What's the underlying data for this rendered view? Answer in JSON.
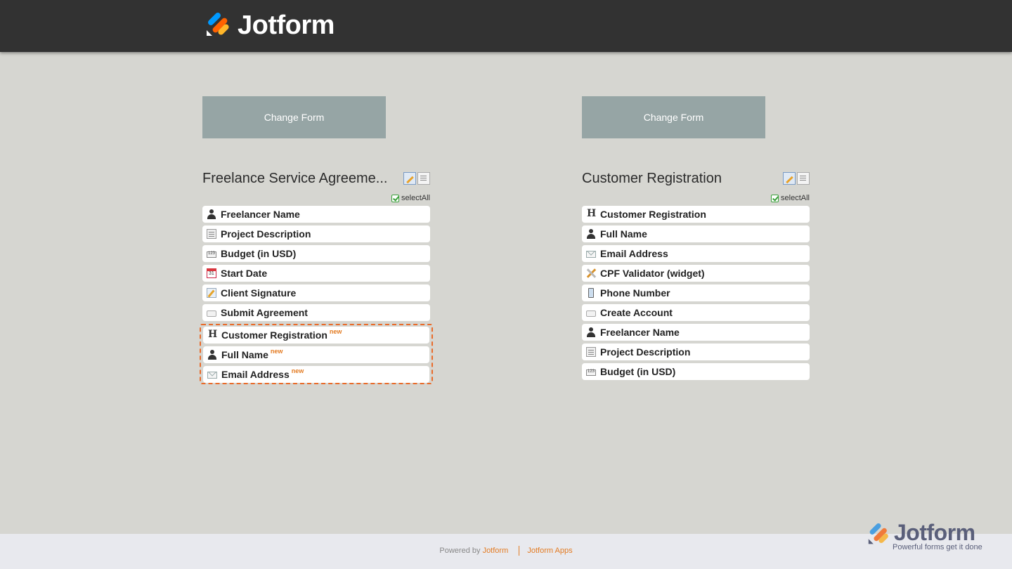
{
  "header": {
    "logo_text": "Jotform",
    "brand_colors": {
      "orange": "#ff6100",
      "yellow": "#ffb629",
      "blue": "#0099ff",
      "dark": "#323232"
    }
  },
  "left_form": {
    "change_label": "Change Form",
    "title": "Freelance Service Agreeme...",
    "select_all_label": "selectAll",
    "fields": [
      {
        "label": "Freelancer Name",
        "icon": "person-icon"
      },
      {
        "label": "Project Description",
        "icon": "textarea-icon"
      },
      {
        "label": "Budget (in USD)",
        "icon": "number-icon"
      },
      {
        "label": "Start Date",
        "icon": "calendar-icon"
      },
      {
        "label": "Client Signature",
        "icon": "signature-icon"
      },
      {
        "label": "Submit Agreement",
        "icon": "button-icon"
      }
    ],
    "new_fields": [
      {
        "label": "Customer Registration",
        "icon": "heading-icon",
        "tag": "new"
      },
      {
        "label": "Full Name",
        "icon": "person-icon",
        "tag": "new"
      },
      {
        "label": "Email Address",
        "icon": "email-icon",
        "tag": "new"
      }
    ]
  },
  "right_form": {
    "change_label": "Change Form",
    "title": "Customer Registration",
    "select_all_label": "selectAll",
    "fields": [
      {
        "label": "Customer Registration",
        "icon": "heading-icon"
      },
      {
        "label": "Full Name",
        "icon": "person-icon"
      },
      {
        "label": "Email Address",
        "icon": "email-icon"
      },
      {
        "label": "CPF Validator (widget)",
        "icon": "widget-icon"
      },
      {
        "label": "Phone Number",
        "icon": "phone-icon"
      },
      {
        "label": "Create Account",
        "icon": "button-icon"
      },
      {
        "label": "Freelancer Name",
        "icon": "person-icon"
      },
      {
        "label": "Project Description",
        "icon": "textarea-icon"
      },
      {
        "label": "Budget (in USD)",
        "icon": "number-icon"
      }
    ]
  },
  "footer": {
    "powered_by": "Powered by",
    "jotform_link": "Jotform",
    "apps_link": "Jotform Apps",
    "brand_name": "Jotform",
    "brand_tagline": "Powerful forms get it done"
  }
}
